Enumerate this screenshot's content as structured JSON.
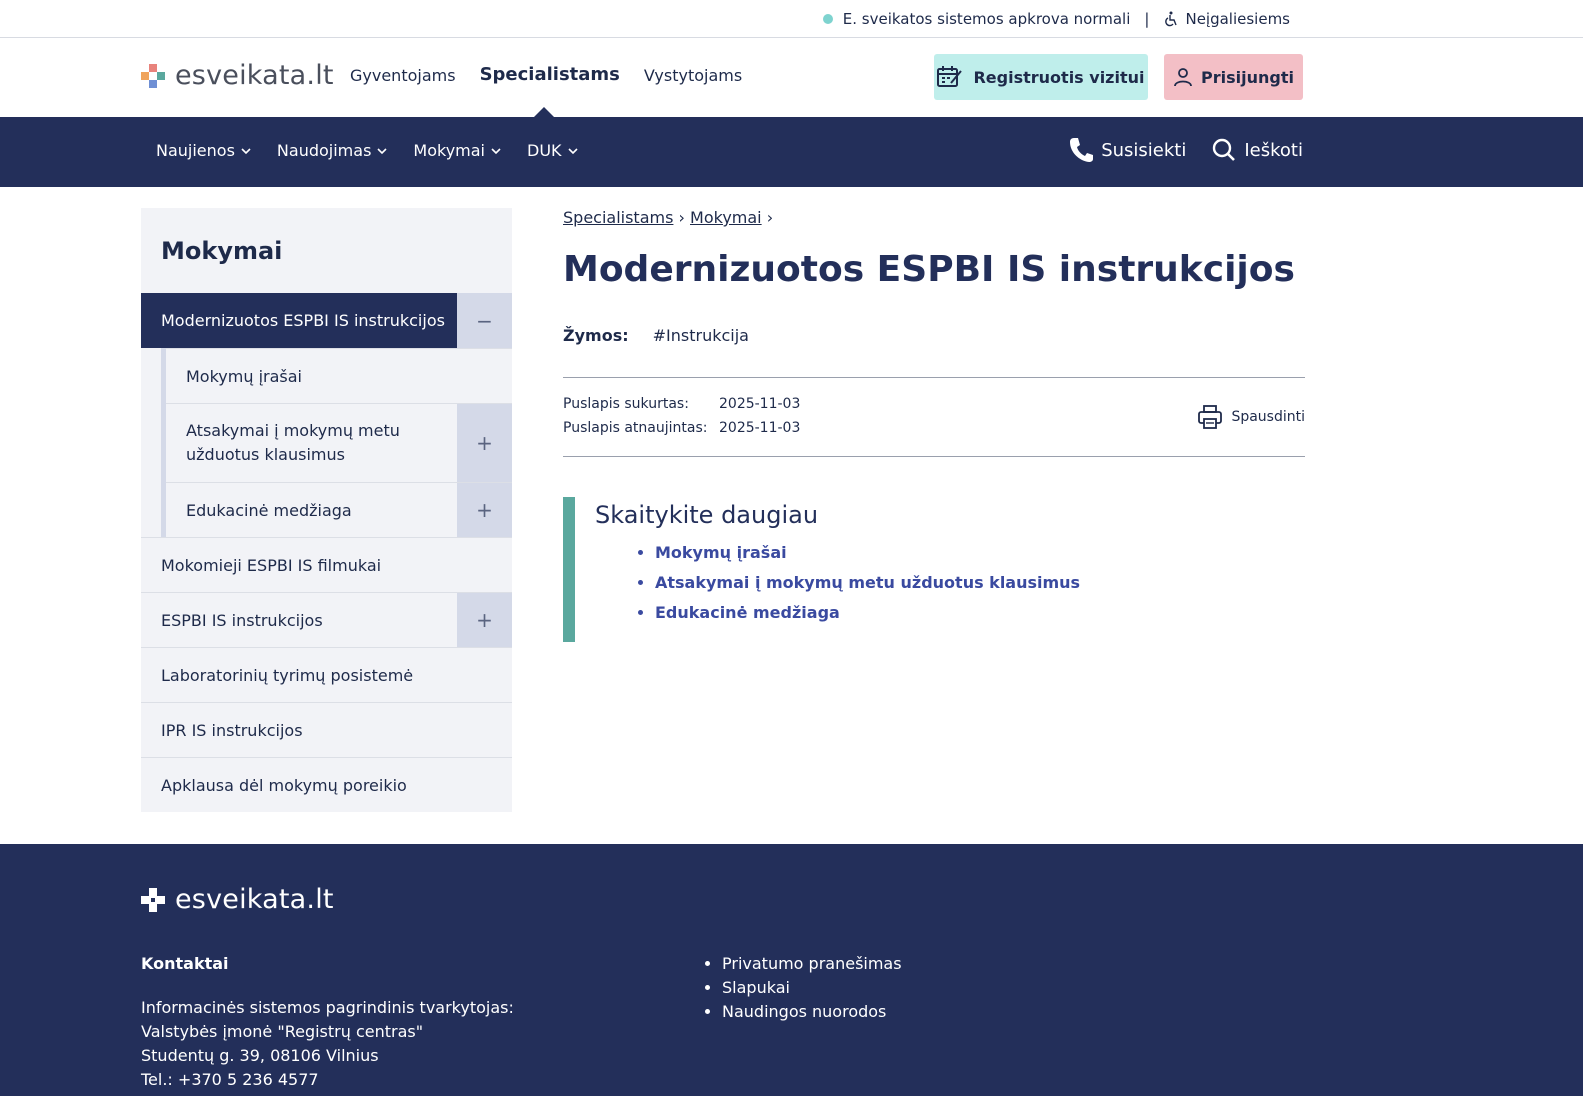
{
  "status": {
    "text": "E. sveikatos sistemos apkrova normali",
    "separator": "|",
    "accessibility": "Neįgaliesiems"
  },
  "header": {
    "logo": "esveikata.lt",
    "nav": [
      {
        "label": "Gyventojams",
        "active": false
      },
      {
        "label": "Specialistams",
        "active": true
      },
      {
        "label": "Vystytojams",
        "active": false
      }
    ],
    "register": "Registruotis vizitui",
    "login": "Prisijungti"
  },
  "navbar": {
    "items": [
      "Naujienos",
      "Naudojimas",
      "Mokymai",
      "DUK"
    ],
    "contact": "Susisiekti",
    "search": "Ieškoti"
  },
  "sidebar": {
    "title": "Mokymai",
    "active": "Modernizuotos ESPBI IS instrukcijos",
    "sub": [
      {
        "label": "Mokymų įrašai",
        "expandable": false
      },
      {
        "label": "Atsakymai į mokymų metu užduotus klausimus",
        "expandable": true
      },
      {
        "label": "Edukacinė medžiaga",
        "expandable": true
      }
    ],
    "items": [
      {
        "label": "Mokomieji ESPBI IS filmukai",
        "expandable": false
      },
      {
        "label": "ESPBI IS instrukcijos",
        "expandable": true
      },
      {
        "label": "Laboratorinių tyrimų posistemė",
        "expandable": false
      },
      {
        "label": "IPR IS instrukcijos",
        "expandable": false
      },
      {
        "label": "Apklausa dėl mokymų poreikio",
        "expandable": false
      }
    ],
    "collapse_symbol": "−",
    "expand_symbol": "+"
  },
  "main": {
    "breadcrumb": [
      "Specialistams",
      "Mokymai"
    ],
    "breadcrumb_sep": "›",
    "title": "Modernizuotos ESPBI IS instrukcijos",
    "tags_label": "Žymos:",
    "tag": "#Instrukcija",
    "created_label": "Puslapis sukurtas:",
    "created": "2025-11-03",
    "updated_label": "Puslapis atnaujintas:",
    "updated": "2025-11-03",
    "print": "Spausdinti",
    "readmore_title": "Skaitykite daugiau",
    "readmore_links": [
      "Mokymų įrašai",
      "Atsakymai į mokymų metu užduotus klausimus",
      "Edukacinė medžiaga"
    ]
  },
  "footer": {
    "logo": "esveikata.lt",
    "contacts_title": "Kontaktai",
    "contacts_lines": [
      "Informacinės sistemos pagrindinis tvarkytojas:",
      "Valstybės įmonė \"Registrų centras\"",
      "Studentų g. 39, 08106 Vilnius",
      "Tel.: +370 5 236 4577"
    ],
    "links": [
      "Privatumo pranešimas",
      "Slapukai",
      "Naudingos nuorodos"
    ]
  },
  "colors": {
    "navy": "#232f5a",
    "teal_button": "#bfeeeb",
    "pink_button": "#f3bfc6",
    "accent_green": "#5aa89e",
    "link_blue": "#3a4aa0"
  }
}
